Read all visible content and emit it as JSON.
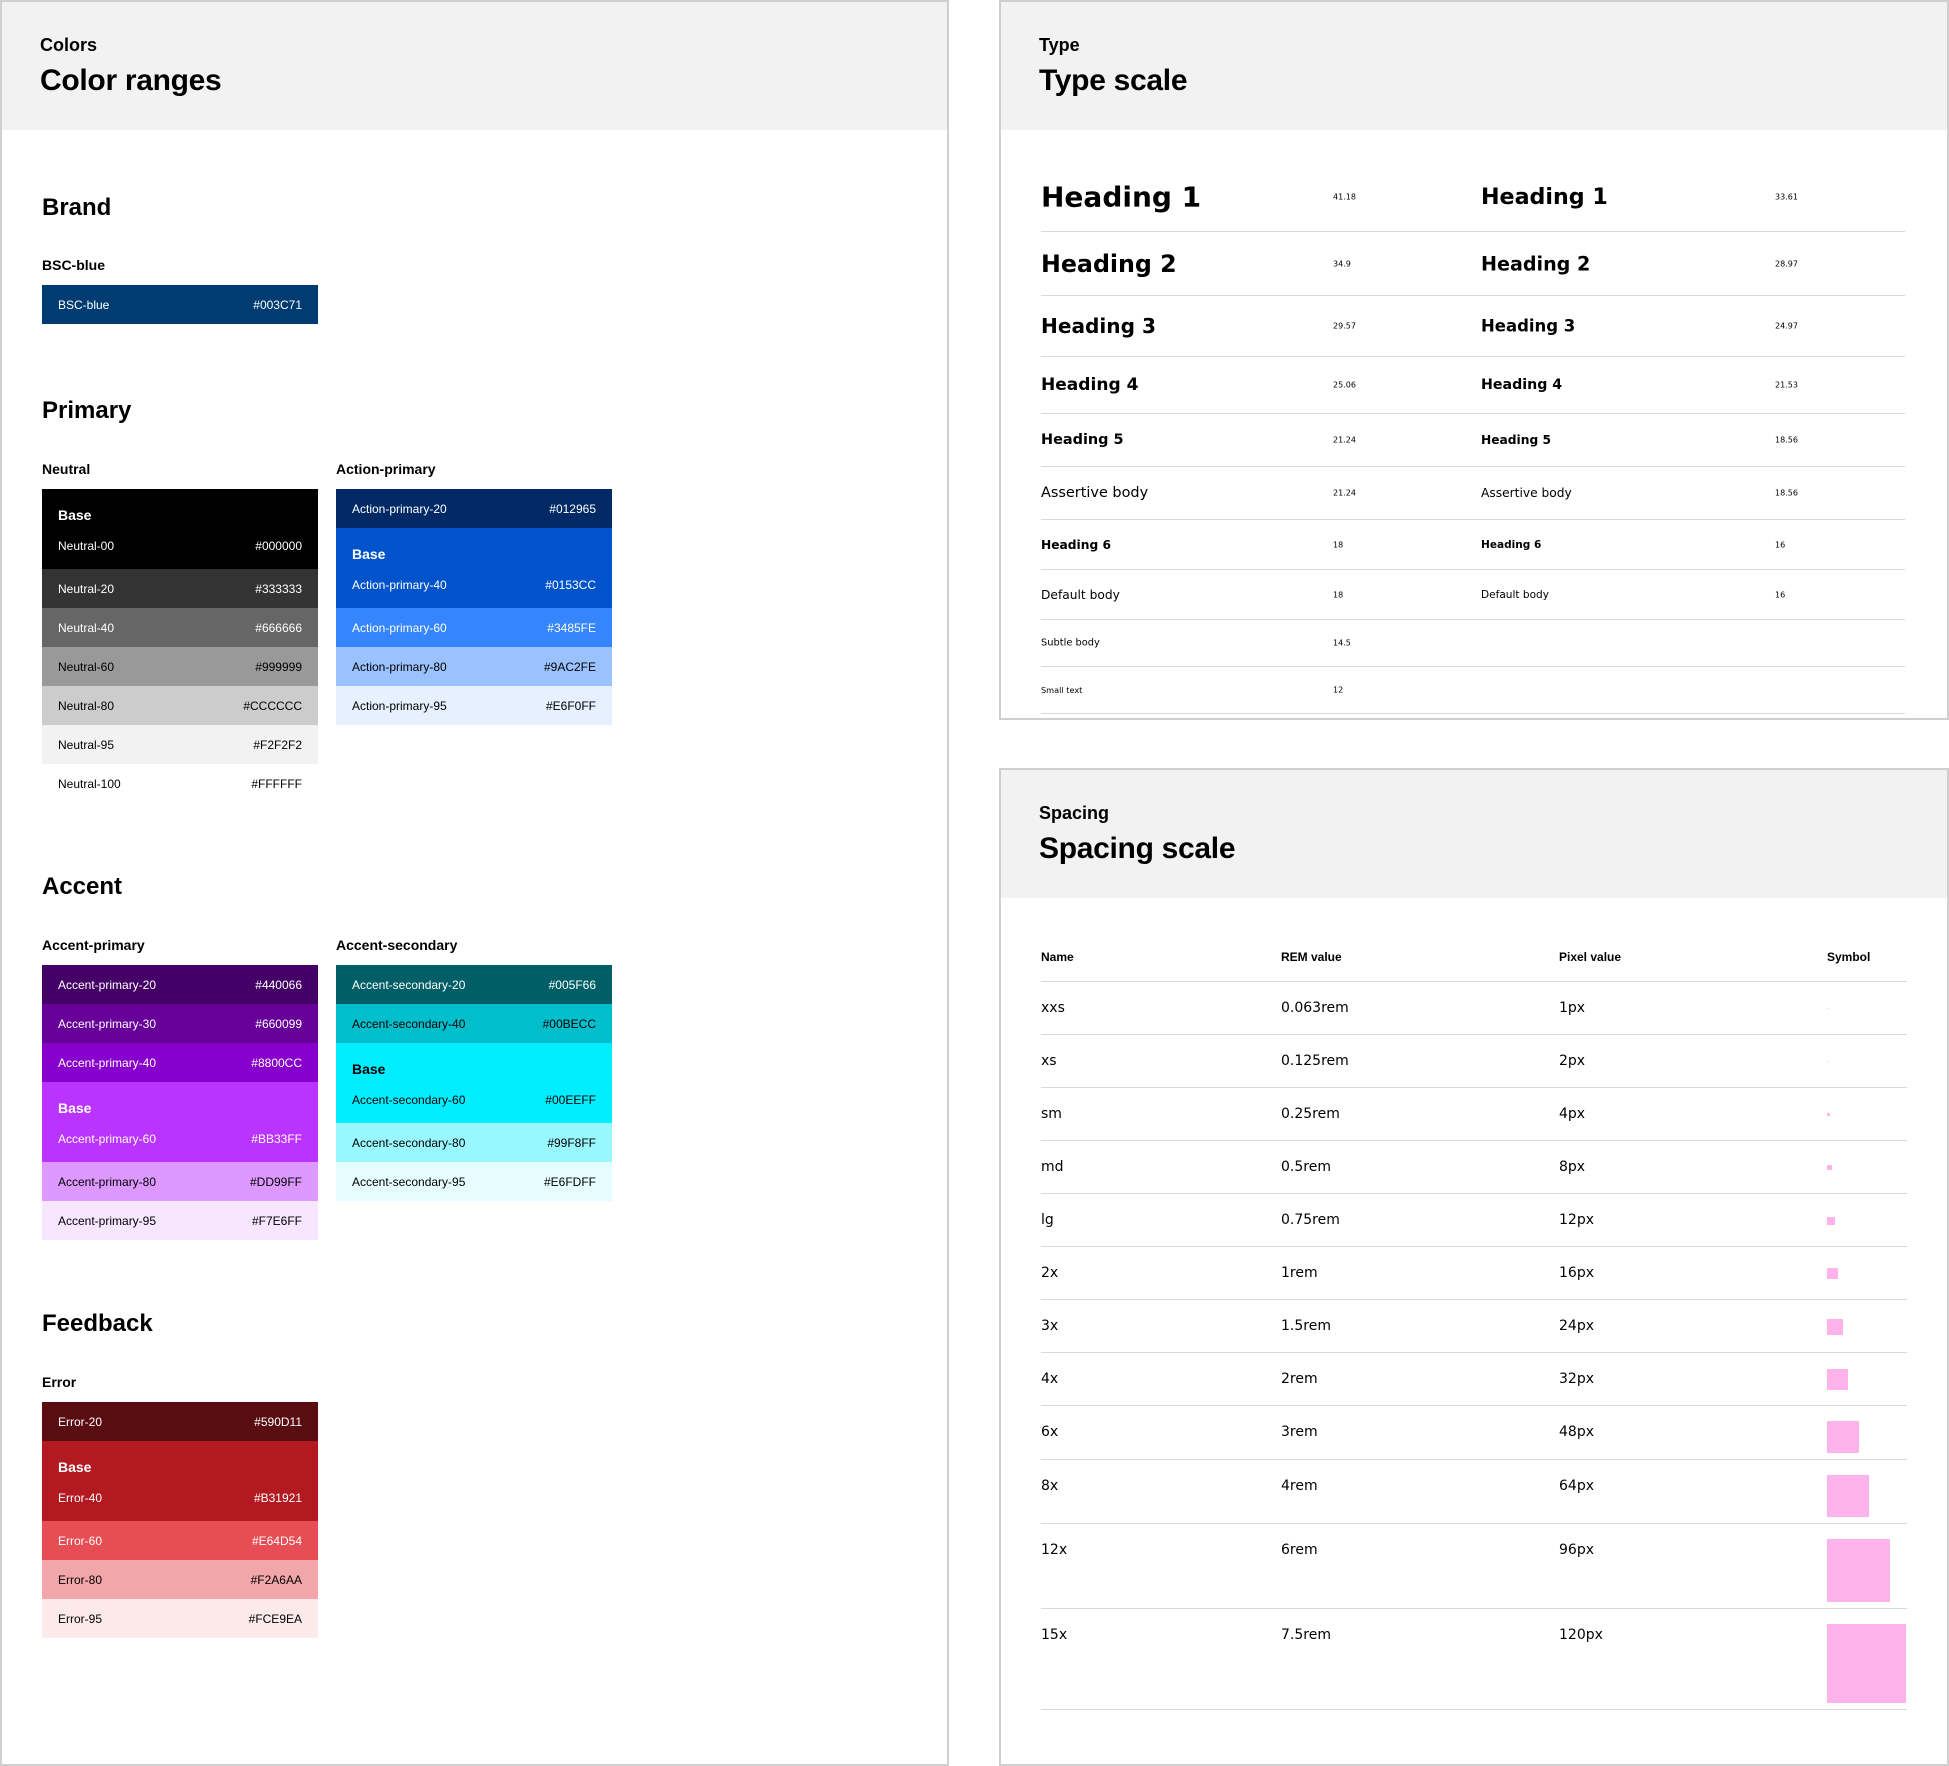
{
  "colors": {
    "eyebrow": "Colors",
    "title": "Color ranges",
    "brand": {
      "title": "Brand",
      "ramp_label": "BSC-blue",
      "swatches": [
        {
          "name": "BSC-blue",
          "hex": "#003C71",
          "color": "#003C71"
        }
      ]
    },
    "primary": {
      "title": "Primary",
      "neutral_label": "Neutral",
      "action_label": "Action-primary",
      "base_label": "Base",
      "neutral": [
        {
          "name": "Neutral-00",
          "hex": "#000000",
          "color": "#000000",
          "base": true
        },
        {
          "name": "Neutral-20",
          "hex": "#333333",
          "color": "#333333"
        },
        {
          "name": "Neutral-40",
          "hex": "#666666",
          "color": "#666666"
        },
        {
          "name": "Neutral-60",
          "hex": "#999999",
          "color": "#999999"
        },
        {
          "name": "Neutral-80",
          "hex": "#CCCCCC",
          "color": "#CCCCCC"
        },
        {
          "name": "Neutral-95",
          "hex": "#F2F2F2",
          "color": "#F2F2F2"
        },
        {
          "name": "Neutral-100",
          "hex": "#FFFFFF",
          "color": "#FFFFFF"
        }
      ],
      "action": [
        {
          "name": "Action-primary-20",
          "hex": "#012965",
          "color": "#012965"
        },
        {
          "name": "Action-primary-40",
          "hex": "#0153CC",
          "color": "#0153CC",
          "base": true
        },
        {
          "name": "Action-primary-60",
          "hex": "#3485FE",
          "color": "#3485FE"
        },
        {
          "name": "Action-primary-80",
          "hex": "#9AC2FE",
          "color": "#9AC2FE"
        },
        {
          "name": "Action-primary-95",
          "hex": "#E6F0FF",
          "color": "#E6F0FF"
        }
      ]
    },
    "accent": {
      "title": "Accent",
      "primary_label": "Accent-primary",
      "secondary_label": "Accent-secondary",
      "base_label": "Base",
      "primary": [
        {
          "name": "Accent-primary-20",
          "hex": "#440066",
          "color": "#440066"
        },
        {
          "name": "Accent-primary-30",
          "hex": "#660099",
          "color": "#660099"
        },
        {
          "name": "Accent-primary-40",
          "hex": "#8800CC",
          "color": "#8800CC"
        },
        {
          "name": "Accent-primary-60",
          "hex": "#BB33FF",
          "color": "#BB33FF",
          "base": true
        },
        {
          "name": "Accent-primary-80",
          "hex": "#DD99FF",
          "color": "#DD99FF"
        },
        {
          "name": "Accent-primary-95",
          "hex": "#F7E6FF",
          "color": "#F7E6FF"
        }
      ],
      "secondary": [
        {
          "name": "Accent-secondary-20",
          "hex": "#005F66",
          "color": "#005F66"
        },
        {
          "name": "Accent-secondary-40",
          "hex": "#00BECC",
          "color": "#00BECC"
        },
        {
          "name": "Accent-secondary-60",
          "hex": "#00EEFF",
          "color": "#00EEFF",
          "base": true
        },
        {
          "name": "Accent-secondary-80",
          "hex": "#99F8FF",
          "color": "#99F8FF"
        },
        {
          "name": "Accent-secondary-95",
          "hex": "#E6FDFF",
          "color": "#E6FDFF"
        }
      ]
    },
    "feedback": {
      "title": "Feedback",
      "error_label": "Error",
      "base_label": "Base",
      "error": [
        {
          "name": "Error-20",
          "hex": "#590D11",
          "color": "#590D11"
        },
        {
          "name": "Error-40",
          "hex": "#B31921",
          "color": "#B31921",
          "base": true
        },
        {
          "name": "Error-60",
          "hex": "#E64D54",
          "color": "#E64D54"
        },
        {
          "name": "Error-80",
          "hex": "#F2A6AA",
          "color": "#F2A6AA"
        },
        {
          "name": "Error-95",
          "hex": "#FCE9EA",
          "color": "#FCE9EA"
        }
      ]
    }
  },
  "type": {
    "eyebrow": "Type",
    "title": "Type scale",
    "rows": [
      {
        "name": "Heading 1",
        "size_lg": "41.18",
        "size_sm": "33.61",
        "weight": "bold"
      },
      {
        "name": "Heading 2",
        "size_lg": "34.9",
        "size_sm": "28.97",
        "weight": "bold"
      },
      {
        "name": "Heading 3",
        "size_lg": "29.57",
        "size_sm": "24.97",
        "weight": "bold"
      },
      {
        "name": "Heading 4",
        "size_lg": "25.06",
        "size_sm": "21.53",
        "weight": "bold"
      },
      {
        "name": "Heading 5",
        "size_lg": "21.24",
        "size_sm": "18.56",
        "weight": "bold"
      },
      {
        "name": "Assertive body",
        "size_lg": "21.24",
        "size_sm": "18.56",
        "weight": "normal"
      },
      {
        "name": "Heading 6",
        "size_lg": "18",
        "size_sm": "16",
        "weight": "bold"
      },
      {
        "name": "Default body",
        "size_lg": "18",
        "size_sm": "16",
        "weight": "normal"
      },
      {
        "name": "Subtle body",
        "size_lg": "14.5",
        "size_sm": "",
        "weight": "normal"
      },
      {
        "name": "Small text",
        "size_lg": "12",
        "size_sm": "",
        "weight": "normal"
      }
    ]
  },
  "spacing": {
    "eyebrow": "Spacing",
    "title": "Spacing scale",
    "headers": {
      "name": "Name",
      "rem": "REM value",
      "px": "Pixel value",
      "symbol": "Symbol"
    },
    "symbol_color": "#FFB3EA",
    "rows": [
      {
        "name": "xxs",
        "rem": "0.063rem",
        "px": "1px",
        "value": 1
      },
      {
        "name": "xs",
        "rem": "0.125rem",
        "px": "2px",
        "value": 2
      },
      {
        "name": "sm",
        "rem": "0.25rem",
        "px": "4px",
        "value": 4
      },
      {
        "name": "md",
        "rem": "0.5rem",
        "px": "8px",
        "value": 8
      },
      {
        "name": "lg",
        "rem": "0.75rem",
        "px": "12px",
        "value": 12
      },
      {
        "name": "2x",
        "rem": "1rem",
        "px": "16px",
        "value": 16
      },
      {
        "name": "3x",
        "rem": "1.5rem",
        "px": "24px",
        "value": 24
      },
      {
        "name": "4x",
        "rem": "2rem",
        "px": "32px",
        "value": 32
      },
      {
        "name": "6x",
        "rem": "3rem",
        "px": "48px",
        "value": 48
      },
      {
        "name": "8x",
        "rem": "4rem",
        "px": "64px",
        "value": 64
      },
      {
        "name": "12x",
        "rem": "6rem",
        "px": "96px",
        "value": 96
      },
      {
        "name": "15x",
        "rem": "7.5rem",
        "px": "120px",
        "value": 120
      }
    ]
  }
}
